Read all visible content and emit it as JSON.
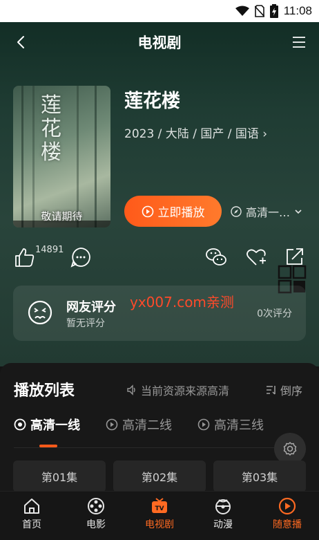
{
  "status_bar": {
    "time": "11:08"
  },
  "header": {
    "title": "电视剧"
  },
  "show": {
    "title": "莲花楼",
    "meta": "2023 / 大陆 / 国产 / 国语",
    "poster_title": "莲花楼",
    "poster_tag": "敬请期待",
    "play_label": "立即播放",
    "quality_label": "高清一…"
  },
  "actions": {
    "like_count": "14891"
  },
  "rating": {
    "title": "网友评分",
    "subtitle": "暂无评分",
    "count": "0次评分"
  },
  "watermark": "yx007.com亲测",
  "playlist": {
    "title": "播放列表",
    "source_note": "当前资源来源高清",
    "sort_label": "倒序",
    "lines": [
      "高清一线",
      "高清二线",
      "高清三线"
    ],
    "episodes": [
      "第01集",
      "第02集",
      "第03集"
    ]
  },
  "nav": {
    "items": [
      "首页",
      "电影",
      "电视剧",
      "动漫",
      "随意播"
    ]
  },
  "colors": {
    "accent": "#ff6a22",
    "background": "#141414",
    "header_bg": "#29443b"
  }
}
